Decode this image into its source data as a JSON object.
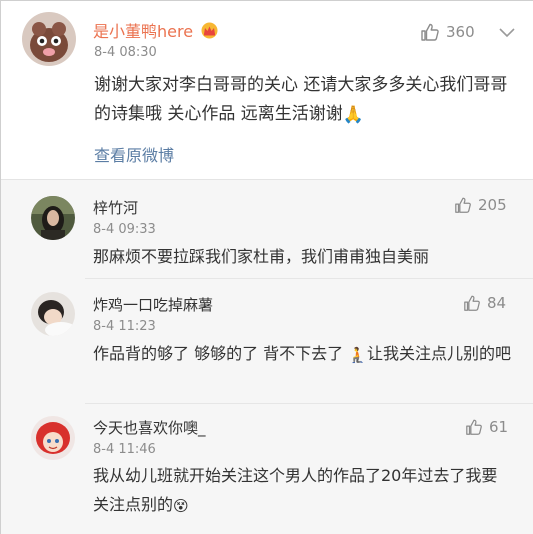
{
  "main_comment": {
    "username": "是小董鸭here",
    "crown_icon": "crown-icon",
    "time": "8-4 08:30",
    "likes": "360",
    "text": "谢谢大家对李白哥哥的关心 还请大家多多关心我们哥哥的诗集哦 关心作品 远离生活谢谢",
    "text_emoji": "🙏",
    "view_original": "查看原微博"
  },
  "replies": [
    {
      "username": "梓竹河",
      "time": "8-4 09:33",
      "likes": "205",
      "text": "那麻烦不要拉踩我们家杜甫，我们甫甫独自美丽",
      "emoji": ""
    },
    {
      "username": "炸鸡一口吃掉麻薯",
      "time": "8-4 11:23",
      "likes": "84",
      "text_a": "作品背的够了 够够的了 背不下去了 ",
      "emoji": "🧎",
      "text_b": "让我关注点儿别的吧"
    },
    {
      "username": "今天也喜欢你噢_",
      "time": "8-4 11:46",
      "likes": "61",
      "text": "我从幼儿班就开始关注这个男人的作品了20年过去了我要关注点别的",
      "emoji": "😵"
    }
  ],
  "colors": {
    "username_orange": "#eb7350",
    "link_blue": "#5b7da4",
    "meta_gray": "#8c8c8c",
    "reply_bg": "#f6f6f6"
  }
}
